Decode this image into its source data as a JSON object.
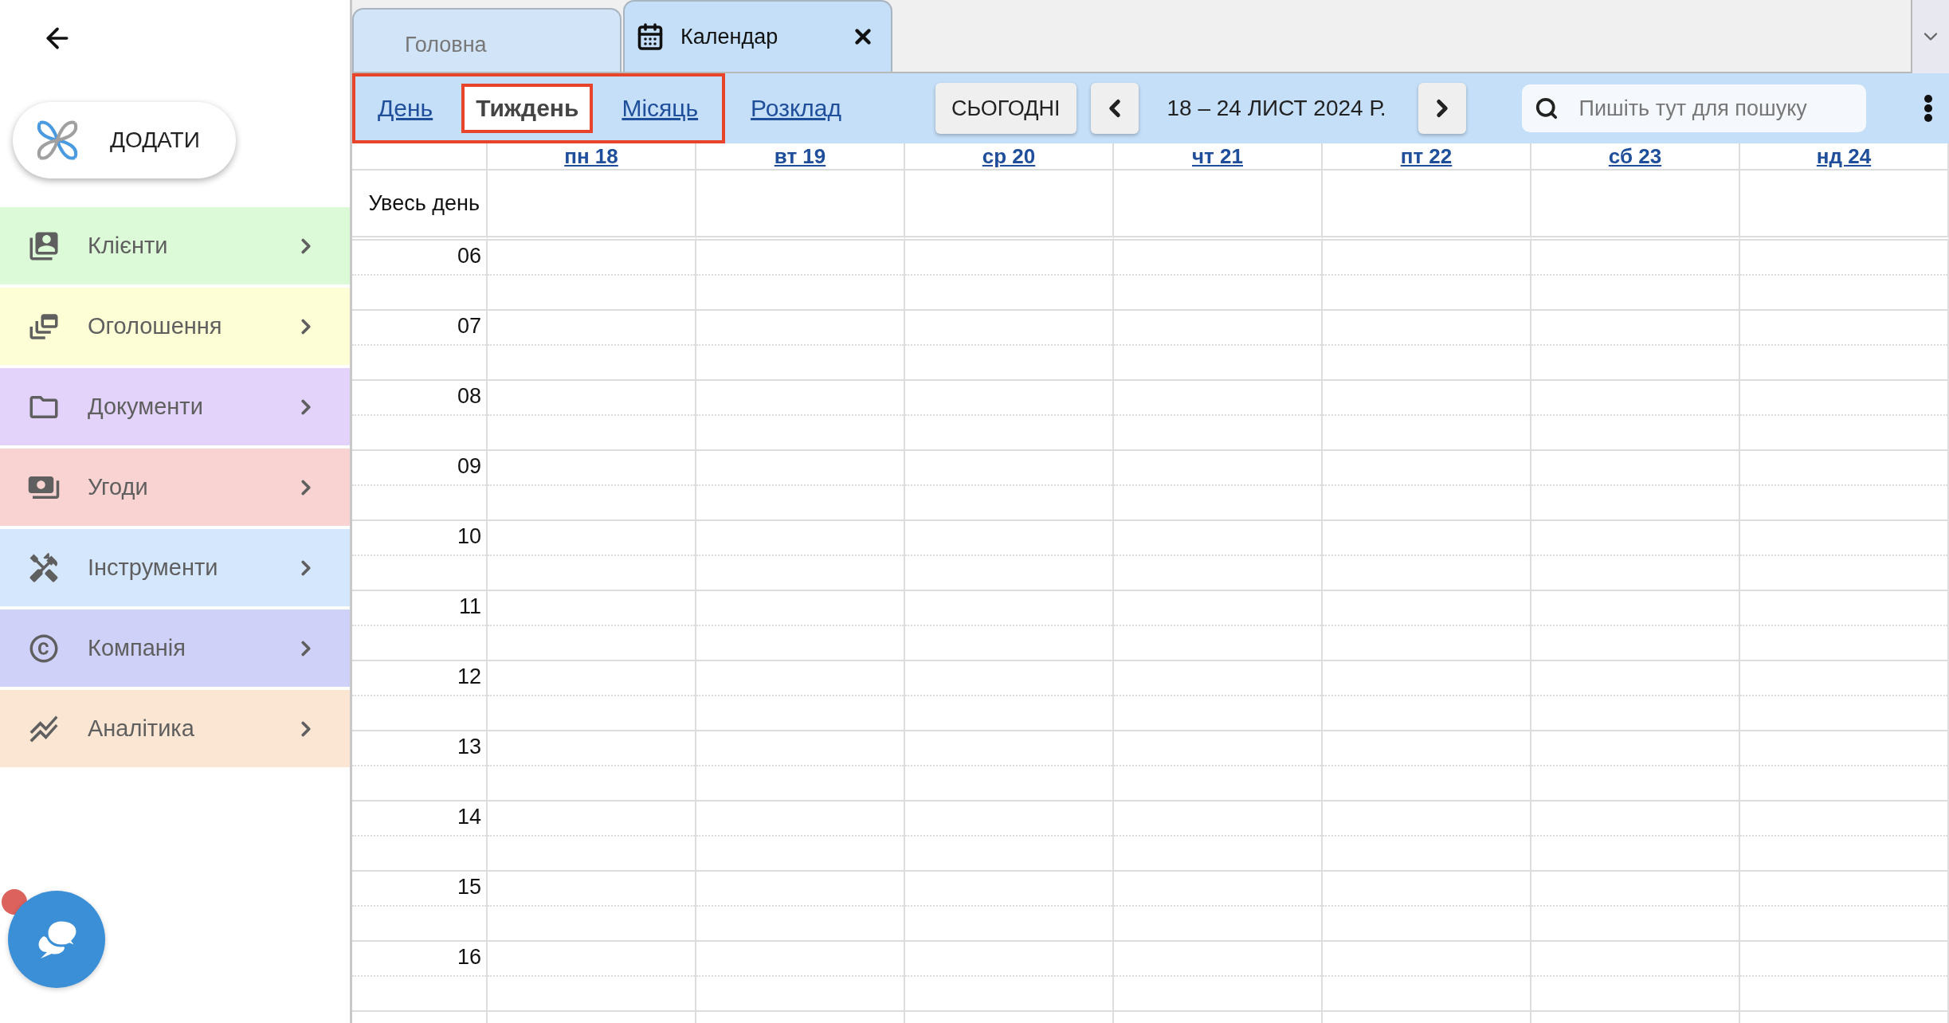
{
  "add_button": {
    "label": "ДОДАТИ"
  },
  "menu": [
    {
      "label": "Клієнти",
      "kind": "clients",
      "color": "#dcfad7"
    },
    {
      "label": "Оголошення",
      "kind": "ads",
      "color": "#fdfdd6"
    },
    {
      "label": "Документи",
      "kind": "documents",
      "color": "#e3d3fb"
    },
    {
      "label": "Угоди",
      "kind": "deals",
      "color": "#f8d3d1"
    },
    {
      "label": "Інструменти",
      "kind": "tools",
      "color": "#d5e7fc"
    },
    {
      "label": "Компанія",
      "kind": "company",
      "color": "#d0d1f8"
    },
    {
      "label": "Аналітика",
      "kind": "analytics",
      "color": "#fae6d3"
    }
  ],
  "chat": {
    "unread": true
  },
  "tabs": [
    {
      "label": "Головна",
      "selected": false,
      "closable": false
    },
    {
      "label": "Календар",
      "selected": true,
      "closable": true
    }
  ],
  "views": [
    {
      "label": "День",
      "selected": false,
      "highlighted": true
    },
    {
      "label": "Тиждень",
      "selected": true,
      "highlighted": true
    },
    {
      "label": "Місяць",
      "selected": false,
      "highlighted": true
    },
    {
      "label": "Розклад",
      "selected": false,
      "highlighted": false
    }
  ],
  "today_button": "СЬОГОДНІ",
  "range": "18 – 24 ЛИСТ 2024 Р.",
  "search": {
    "placeholder": "Пишіть тут для пошуку"
  },
  "days": [
    "пн 18",
    "вт 19",
    "ср 20",
    "чт 21",
    "пт 22",
    "сб 23",
    "нд 24"
  ],
  "all_day_label": "Увесь день",
  "hours": [
    "06",
    "07",
    "08",
    "09",
    "10",
    "11",
    "12",
    "13",
    "14",
    "15",
    "16"
  ]
}
